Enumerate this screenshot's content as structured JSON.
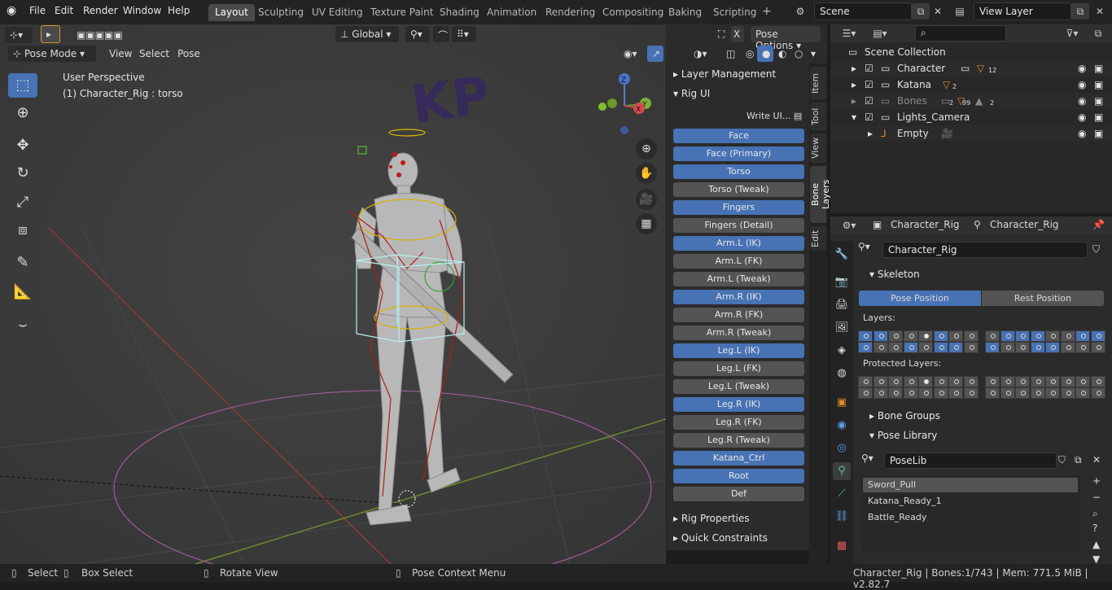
{
  "topbar": {
    "menus": [
      "File",
      "Edit",
      "Render",
      "Window",
      "Help"
    ],
    "workspaces": [
      "Layout",
      "Sculpting",
      "UV Editing",
      "Texture Paint",
      "Shading",
      "Animation",
      "Rendering",
      "Compositing",
      "Baking",
      "Scripting"
    ],
    "add_tab": "+",
    "scene": "Scene",
    "view_layer": "View Layer"
  },
  "viewport": {
    "transform_orientation": "Global",
    "pose_options": "Pose Options",
    "mode": "Pose Mode",
    "menus": [
      "View",
      "Select",
      "Pose"
    ],
    "perspective": "User Perspective",
    "object_info": "(1) Character_Rig : torso",
    "overlay_text": "KP",
    "gizmo_axes": [
      "Z",
      "Y",
      "X"
    ],
    "x_close": "X"
  },
  "npanel": {
    "panels": [
      "Layer Management",
      "Rig UI",
      "Rig Properties",
      "Quick Constraints"
    ],
    "write_ui": "Write UI...",
    "rig_buttons": [
      {
        "label": "Face",
        "on": true
      },
      {
        "label": "Face (Primary)",
        "on": true
      },
      {
        "label": "Torso",
        "on": true
      },
      {
        "label": "Torso (Tweak)",
        "on": false
      },
      {
        "label": "Fingers",
        "on": true
      },
      {
        "label": "Fingers (Detail)",
        "on": false
      },
      {
        "label": "Arm.L (IK)",
        "on": true
      },
      {
        "label": "Arm.L (FK)",
        "on": false
      },
      {
        "label": "Arm.L (Tweak)",
        "on": false
      },
      {
        "label": "Arm.R (IK)",
        "on": true
      },
      {
        "label": "Arm.R (FK)",
        "on": false
      },
      {
        "label": "Arm.R (Tweak)",
        "on": false
      },
      {
        "label": "Leg.L (IK)",
        "on": true
      },
      {
        "label": "Leg.L (FK)",
        "on": false
      },
      {
        "label": "Leg.L (Tweak)",
        "on": false
      },
      {
        "label": "Leg.R (IK)",
        "on": true
      },
      {
        "label": "Leg.R (FK)",
        "on": false
      },
      {
        "label": "Leg.R (Tweak)",
        "on": false
      },
      {
        "label": "Katana_Ctrl",
        "on": true
      },
      {
        "label": "Root",
        "on": true
      },
      {
        "label": "Def",
        "on": false
      }
    ],
    "tabs": [
      "Item",
      "Tool",
      "View",
      "Bone Layers",
      "Edit"
    ]
  },
  "outliner": {
    "search_placeholder": "",
    "root": "Scene Collection",
    "rows": [
      {
        "name": "Character",
        "count": "12"
      },
      {
        "name": "Katana",
        "count": "2"
      },
      {
        "name": "Bones",
        "count": "99"
      },
      {
        "name": "Lights_Camera",
        "count": ""
      },
      {
        "name": "Empty",
        "count": ""
      }
    ],
    "bones_sub": "2",
    "bones_sub2": "2"
  },
  "properties": {
    "breadcrumb_object": "Character_Rig",
    "breadcrumb_data": "Character_Rig",
    "data_name": "Character_Rig",
    "skeleton": "Skeleton",
    "pose_position": "Pose Position",
    "rest_position": "Rest Position",
    "layers_label": "Layers:",
    "protected_label": "Protected Layers:",
    "bone_groups": "Bone Groups",
    "pose_library": "Pose Library",
    "poselib_name": "PoseLib",
    "poses": [
      "Sword_Pull",
      "Katana_Ready_1",
      "Battle_Ready"
    ]
  },
  "status": {
    "select": "Select",
    "box_select": "Box Select",
    "rotate_view": "Rotate View",
    "context_menu": "Pose Context Menu",
    "info": "Character_Rig | Bones:1/743  |  Mem: 771.5 MiB | v2.82.7"
  },
  "colors": {
    "accent": "#4772b3",
    "viewport_bg": "#3d3d3d",
    "panel_bg": "#2b2b2b"
  }
}
